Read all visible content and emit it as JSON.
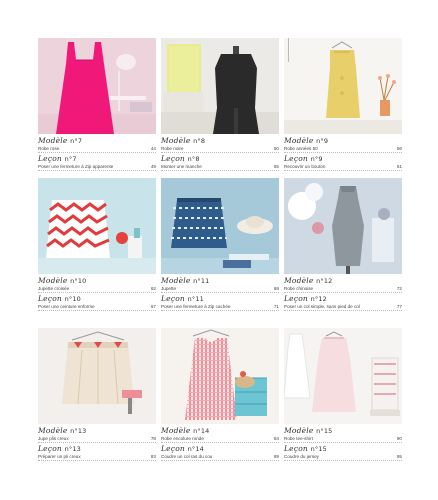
{
  "entries": [
    {
      "modele": "Modèle",
      "modele_num": "n°7",
      "title": "Robe rose",
      "title_page": "44",
      "lecon": "Leçon",
      "lecon_num": "n°7",
      "lecon_title": "Poser une fermeture à Zip apparente",
      "lecon_page": "49"
    },
    {
      "modele": "Modèle",
      "modele_num": "n°8",
      "title": "Robe noire",
      "title_page": "50",
      "lecon": "Leçon",
      "lecon_num": "n°8",
      "lecon_title": "Monter une manche",
      "lecon_page": "55"
    },
    {
      "modele": "Modèle",
      "modele_num": "n°9",
      "title": "Robe années 50",
      "title_page": "56",
      "lecon": "Leçon",
      "lecon_num": "n°9",
      "lecon_title": "Recouvrir un bouton",
      "lecon_page": "61"
    },
    {
      "modele": "Modèle",
      "modele_num": "n°10",
      "title": "Jupette croisée",
      "title_page": "62",
      "lecon": "Leçon",
      "lecon_num": "n°10",
      "lecon_title": "Poser une ceinture enforme",
      "lecon_page": "67"
    },
    {
      "modele": "Modèle",
      "modele_num": "n°11",
      "title": "Jupette",
      "title_page": "68",
      "lecon": "Leçon",
      "lecon_num": "n°11",
      "lecon_title": "Poser une fermeture à Zip cachée",
      "lecon_page": "71"
    },
    {
      "modele": "Modèle",
      "modele_num": "n°12",
      "title": "Robe chinoise",
      "title_page": "72",
      "lecon": "Leçon",
      "lecon_num": "n°12",
      "lecon_title": "Poser un col simple, sans pied de col",
      "lecon_page": "77"
    },
    {
      "modele": "Modèle",
      "modele_num": "n°13",
      "title": "Jupe plis creux",
      "title_page": "78",
      "lecon": "Leçon",
      "lecon_num": "n°13",
      "lecon_title": "Préparer un pli creux",
      "lecon_page": "83"
    },
    {
      "modele": "Modèle",
      "modele_num": "n°14",
      "title": "Robe encolure ronde",
      "title_page": "84",
      "lecon": "Leçon",
      "lecon_num": "n°14",
      "lecon_title": "Coudre un col ras du cou",
      "lecon_page": "89"
    },
    {
      "modele": "Modèle",
      "modele_num": "n°15",
      "title": "Robe tee-shirt",
      "title_page": "90",
      "lecon": "Leçon",
      "lecon_num": "n°15",
      "lecon_title": "Coudre du jersey",
      "lecon_page": "95"
    }
  ],
  "photos": [
    {
      "icon": "pink-dress-photo",
      "bg": "#efd6de",
      "accent": "#f0197a"
    },
    {
      "icon": "black-dress-photo",
      "bg": "#ecebe7",
      "accent": "#2a2a2a"
    },
    {
      "icon": "yellow-dress-photo",
      "bg": "#f6f5f2",
      "accent": "#e9cf6a"
    },
    {
      "icon": "chevron-skirt-photo",
      "bg": "#c9e3ea",
      "accent": "#e23b3b"
    },
    {
      "icon": "blue-skirt-photo",
      "bg": "#a6c9d9",
      "accent": "#2f5c8c"
    },
    {
      "icon": "grey-dress-photo",
      "bg": "#cfd9e4",
      "accent": "#8e969e"
    },
    {
      "icon": "beige-skirt-photo",
      "bg": "#f2efec",
      "accent": "#e5cdb3"
    },
    {
      "icon": "check-dress-photo",
      "bg": "#f6f3ef",
      "accent": "#ef8e96"
    },
    {
      "icon": "white-dress-photo",
      "bg": "#f5f4f2",
      "accent": "#f6dde0"
    }
  ]
}
